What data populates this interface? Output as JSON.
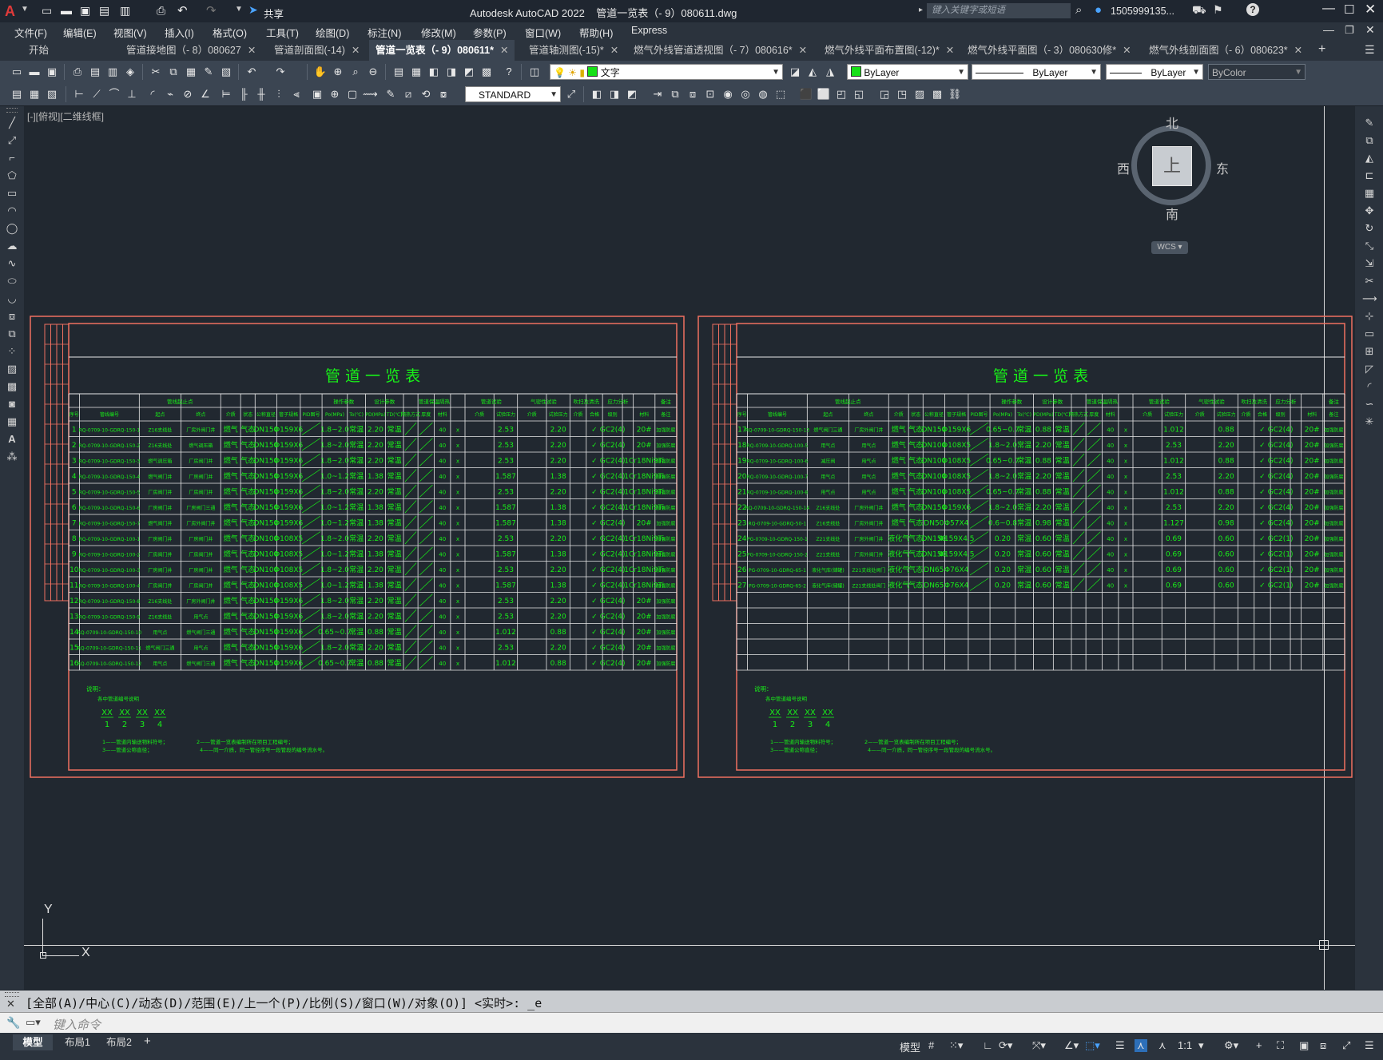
{
  "app": {
    "title": "Autodesk AutoCAD 2022    管道一览表（- 9）080611.dwg",
    "share_label": "共享",
    "search_placeholder": "键入关键字或短语",
    "user": "1505999135..."
  },
  "menu": [
    "文件(F)",
    "编辑(E)",
    "视图(V)",
    "插入(I)",
    "格式(O)",
    "工具(T)",
    "绘图(D)",
    "标注(N)",
    "修改(M)",
    "参数(P)",
    "窗口(W)",
    "帮助(H)",
    "Express"
  ],
  "tabs": [
    {
      "label": "开始",
      "closable": false
    },
    {
      "label": "管道接地图（- 8）080627",
      "closable": true
    },
    {
      "label": "管道剖面图(-14)",
      "closable": true
    },
    {
      "label": "管道一览表（- 9）080611*",
      "closable": true,
      "active": true
    },
    {
      "label": "管道轴测图(-15)*",
      "closable": true
    },
    {
      "label": "燃气外线管道透视图（- 7）080616*",
      "closable": true
    },
    {
      "label": "燃气外线平面布置图(-12)*",
      "closable": true
    },
    {
      "label": "燃气外线平面图（- 3）080630修*",
      "closable": true
    },
    {
      "label": "燃气外线剖面图（- 6）080623*",
      "closable": true
    }
  ],
  "toolbar": {
    "layer_value": "文字",
    "color_value": "ByLayer",
    "linetype_value": "ByLayer",
    "lineweight_value": "ByLayer",
    "plotstyle_value": "ByColor",
    "textstyle_value": "STANDARD"
  },
  "viewport_label": "[-][俯视][二维线框]",
  "viewcube": {
    "north": "北",
    "south": "南",
    "east": "东",
    "west": "西",
    "top": "上",
    "wcs": "WCS"
  },
  "ucs": {
    "x": "X",
    "y": "Y"
  },
  "drawing": {
    "title": "管  道  一  览  表",
    "header_groups": [
      "管线起止点",
      "操作参数",
      "设计参数",
      "管道保温隔热",
      "管道试验",
      "气密性试验",
      "吹扫及清洗",
      "应力分析",
      "备注"
    ],
    "header_cols": [
      "序号",
      "管线编号",
      "起点",
      "终点",
      "介质",
      "状态",
      "公称直径",
      "管子规格",
      "PID图号",
      "Po(MPa)",
      "To(℃)",
      "PD(MPa)",
      "TD(℃)",
      "隔热方式",
      "厚度",
      "材料",
      "介质",
      "试验压力",
      "介质",
      "试验压力",
      "介质",
      "合格",
      "级别",
      "材料",
      "备注"
    ],
    "left_rows": [
      [
        "1",
        "RQ-0709-10-GDRQ-150-1",
        "Z16支线处",
        "厂房外阀门井",
        "燃气",
        "气态",
        "DN150",
        "Φ159X6",
        "1.8~2.0",
        "常温",
        "2.20",
        "常温",
        "2.53",
        "2.20",
        "GC2(4)",
        "20#",
        "加强防腐"
      ],
      [
        "2",
        "RQ-0709-10-GDRQ-150-2",
        "Z16支线处",
        "燃气调压箱",
        "燃气",
        "气态",
        "DN150",
        "Φ159X6",
        "1.8~2.0",
        "常温",
        "2.20",
        "常温",
        "2.53",
        "2.20",
        "GC2(4)",
        "20#",
        "加强防腐"
      ],
      [
        "3",
        "RQ-0709-10-GDRQ-150-3",
        "燃气调压箱",
        "厂房阀门井",
        "燃气",
        "气态",
        "DN150",
        "Φ159X6",
        "1.8~2.0",
        "常温",
        "2.20",
        "常温",
        "2.53",
        "2.20",
        "GC2(4)",
        "1Cr18Ni9Ti",
        "加强防腐"
      ],
      [
        "4",
        "RQ-0709-10-GDRQ-150-4",
        "燃气阀门井",
        "厂房阀门井",
        "燃气",
        "气态",
        "DN150",
        "Φ159X6",
        "1.0~1.2",
        "常温",
        "1.38",
        "常温",
        "1.587",
        "1.38",
        "GC2(4)",
        "1Cr18Ni9Ti",
        "加强防腐"
      ],
      [
        "5",
        "RQ-0709-10-GDRQ-150-5",
        "厂房阀门井",
        "厂房阀门井",
        "燃气",
        "气态",
        "DN150",
        "Φ159X6",
        "1.8~2.0",
        "常温",
        "2.20",
        "常温",
        "2.53",
        "2.20",
        "GC2(4)",
        "1Cr18Ni9Ti",
        "加强防腐"
      ],
      [
        "6",
        "RQ-0709-10-GDRQ-150-6",
        "厂房阀门井",
        "厂房阀门三通",
        "燃气",
        "气态",
        "DN150",
        "Φ159X6",
        "1.0~1.2",
        "常温",
        "1.38",
        "常温",
        "1.587",
        "1.38",
        "GC2(4)",
        "1Cr18Ni9Ti",
        "加强防腐"
      ],
      [
        "7",
        "RQ-0709-10-GDRQ-150-7",
        "燃气阀门井",
        "厂房外阀门井",
        "燃气",
        "气态",
        "DN150",
        "Φ159X6",
        "1.0~1.2",
        "常温",
        "1.38",
        "常温",
        "1.587",
        "1.38",
        "GC2(4)",
        "20#",
        "加强防腐"
      ],
      [
        "8",
        "RQ-0709-10-GDRQ-100-1",
        "厂房阀门井",
        "厂房阀门井",
        "燃气",
        "气态",
        "DN100",
        "Φ108X5",
        "1.8~2.0",
        "常温",
        "2.20",
        "常温",
        "2.53",
        "2.20",
        "GC2(4)",
        "1Cr18Ni9Ti",
        "加强防腐"
      ],
      [
        "9",
        "RQ-0709-10-GDRQ-100-2",
        "厂房阀门井",
        "厂房阀门井",
        "燃气",
        "气态",
        "DN100",
        "Φ108X5",
        "1.0~1.2",
        "常温",
        "1.38",
        "常温",
        "1.587",
        "1.38",
        "GC2(4)",
        "1Cr18Ni9Ti",
        "加强防腐"
      ],
      [
        "10",
        "RQ-0709-10-GDRQ-100-3",
        "厂房阀门井",
        "厂房阀门井",
        "燃气",
        "气态",
        "DN100",
        "Φ108X5",
        "1.8~2.0",
        "常温",
        "2.20",
        "常温",
        "2.53",
        "2.20",
        "GC2(4)",
        "1Cr18Ni9Ti",
        "加强防腐"
      ],
      [
        "11",
        "RQ-0709-10-GDRQ-100-4",
        "厂房阀门井",
        "厂房阀门井",
        "燃气",
        "气态",
        "DN100",
        "Φ108X5",
        "1.0~1.2",
        "常温",
        "1.38",
        "常温",
        "1.587",
        "1.38",
        "GC2(4)",
        "1Cr18Ni9Ti",
        "加强防腐"
      ],
      [
        "12",
        "RQ-0709-10-GDRQ-150-8",
        "Z16支线处",
        "厂房外阀门井",
        "燃气",
        "气态",
        "DN150",
        "Φ159X6",
        "1.8~2.0",
        "常温",
        "2.20",
        "常温",
        "2.53",
        "2.20",
        "GC2(4)",
        "20#",
        "加强防腐"
      ],
      [
        "13",
        "RQ-0709-10-GDRQ-150-9",
        "Z16支线处",
        "用气点",
        "燃气",
        "气态",
        "DN150",
        "Φ159X6",
        "1.8~2.0",
        "常温",
        "2.20",
        "常温",
        "2.53",
        "2.20",
        "GC2(4)",
        "20#",
        "加强防腐"
      ],
      [
        "14",
        "RQ-0709-10-GDRQ-150-10",
        "用气点",
        "燃气阀门三通",
        "燃气",
        "气态",
        "DN150",
        "Φ159X6",
        "0.65~0.7",
        "常温",
        "0.88",
        "常温",
        "1.012",
        "0.88",
        "GC2(4)",
        "20#",
        "加强防腐"
      ],
      [
        "15",
        "RQ-0709-10-GDRQ-150-11",
        "燃气阀门三通",
        "用气点",
        "燃气",
        "气态",
        "DN150",
        "Φ159X6",
        "1.8~2.0",
        "常温",
        "2.20",
        "常温",
        "2.53",
        "2.20",
        "GC2(4)",
        "20#",
        "加强防腐"
      ],
      [
        "16",
        "RQ-0709-10-GDRQ-150-12",
        "用气点",
        "燃气阀门三通",
        "燃气",
        "气态",
        "DN150",
        "Φ159X6",
        "0.65~0.7",
        "常温",
        "0.88",
        "常温",
        "1.012",
        "0.88",
        "GC2(4)",
        "20#",
        "加强防腐"
      ]
    ],
    "right_rows": [
      [
        "17",
        "RQ-0709-10-GDRQ-150-13",
        "燃气阀门三通",
        "厂房外阀门井",
        "燃气",
        "气态",
        "DN150",
        "Φ159X6",
        "0.65~0.7",
        "常温",
        "0.88",
        "常温",
        "1.012",
        "0.88",
        "GC2(4)",
        "20#",
        "加强防腐"
      ],
      [
        "18",
        "RQ-0709-10-GDRQ-100-5",
        "用气点",
        "用气点",
        "燃气",
        "气态",
        "DN100",
        "Φ108X5",
        "1.8~2.0",
        "常温",
        "2.20",
        "常温",
        "2.53",
        "2.20",
        "GC2(4)",
        "20#",
        "加强防腐"
      ],
      [
        "19",
        "RQ-0709-10-GDRQ-100-6",
        "减压阀",
        "用气点",
        "燃气",
        "气态",
        "DN100",
        "Φ108X5",
        "0.65~0.7",
        "常温",
        "0.88",
        "常温",
        "1.012",
        "0.88",
        "GC2(4)",
        "20#",
        "加强防腐"
      ],
      [
        "20",
        "RQ-0709-10-GDRQ-100-7",
        "用气点",
        "用气点",
        "燃气",
        "气态",
        "DN100",
        "Φ108X5",
        "1.8~2.0",
        "常温",
        "2.20",
        "常温",
        "2.53",
        "2.20",
        "GC2(4)",
        "20#",
        "加强防腐"
      ],
      [
        "21",
        "RQ-0709-10-GDRQ-100-8",
        "用气点",
        "用气点",
        "燃气",
        "气态",
        "DN100",
        "Φ108X5",
        "0.65~0.7",
        "常温",
        "0.88",
        "常温",
        "1.012",
        "0.88",
        "GC2(4)",
        "20#",
        "加强防腐"
      ],
      [
        "22",
        "RQ-0709-10-GDRQ-150-14",
        "Z16支线处",
        "厂房外阀门井",
        "燃气",
        "气态",
        "DN150",
        "Φ159X6",
        "1.8~2.0",
        "常温",
        "2.20",
        "常温",
        "2.53",
        "2.20",
        "GC2(4)",
        "20#",
        "加强防腐"
      ],
      [
        "23",
        "RQ-0709-10-GDRQ-50-1",
        "Z16支线处",
        "厂房外阀门井",
        "燃气",
        "气态",
        "DN50",
        "Φ57X4",
        "0.6~0.8",
        "常温",
        "0.98",
        "常温",
        "1.127",
        "0.98",
        "GC2(4)",
        "20#",
        "加强防腐"
      ],
      [
        "24",
        "PG-0709-10-GDRQ-150-1",
        "Z21支线处",
        "厂房外阀门井",
        "液化气",
        "气态",
        "DN150",
        "Φ159X4.5",
        "0.20",
        "常温",
        "0.60",
        "常温",
        "0.69",
        "0.60",
        "GC2(1)",
        "20#",
        "加强防腐"
      ],
      [
        "25",
        "PG-0709-10-GDRQ-150-2",
        "Z21支线处",
        "厂房外阀门井",
        "液化气",
        "气态",
        "DN150",
        "Φ159X4.5",
        "0.20",
        "常温",
        "0.60",
        "常温",
        "0.69",
        "0.60",
        "GC2(1)",
        "20#",
        "加强防腐"
      ],
      [
        "26",
        "PG-0709-10-GDRQ-65-1",
        "液化气库(储罐)",
        "Z21支线处阀门",
        "液化气",
        "气态",
        "DN65",
        "Φ76X4",
        "0.20",
        "常温",
        "0.60",
        "常温",
        "0.69",
        "0.60",
        "GC2(1)",
        "20#",
        "加强防腐"
      ],
      [
        "27",
        "PG-0709-10-GDRQ-65-2",
        "液化气库(储罐)",
        "Z21支线处阀门",
        "液化气",
        "气态",
        "DN65",
        "Φ76X4",
        "0.20",
        "常温",
        "0.60",
        "常温",
        "0.69",
        "0.60",
        "GC2(1)",
        "20#",
        "加强防腐"
      ]
    ],
    "notes_title": "说明：",
    "notes_sub": "各中管道编号说明",
    "notes_xx": [
      "XX",
      "XX",
      "XX",
      "XX"
    ],
    "notes_nums": [
      "1",
      "2",
      "3",
      "4"
    ],
    "notes_lines": [
      "1——管道内输送物料符号；",
      "2——管道一览表编制所在项目工程编号；",
      "3——管道公称直径；",
      "4——同一介质，同一管径序号一段管段的编号流水号。"
    ]
  },
  "command": {
    "history": "[全部(A)/中心(C)/动态(D)/范围(E)/上一个(P)/比例(S)/窗口(W)/对象(O)] <实时>: _e",
    "placeholder": "键入命令"
  },
  "status": {
    "tabs": [
      "模型",
      "布局1",
      "布局2"
    ],
    "model_label": "模型",
    "scale": "1:1"
  }
}
